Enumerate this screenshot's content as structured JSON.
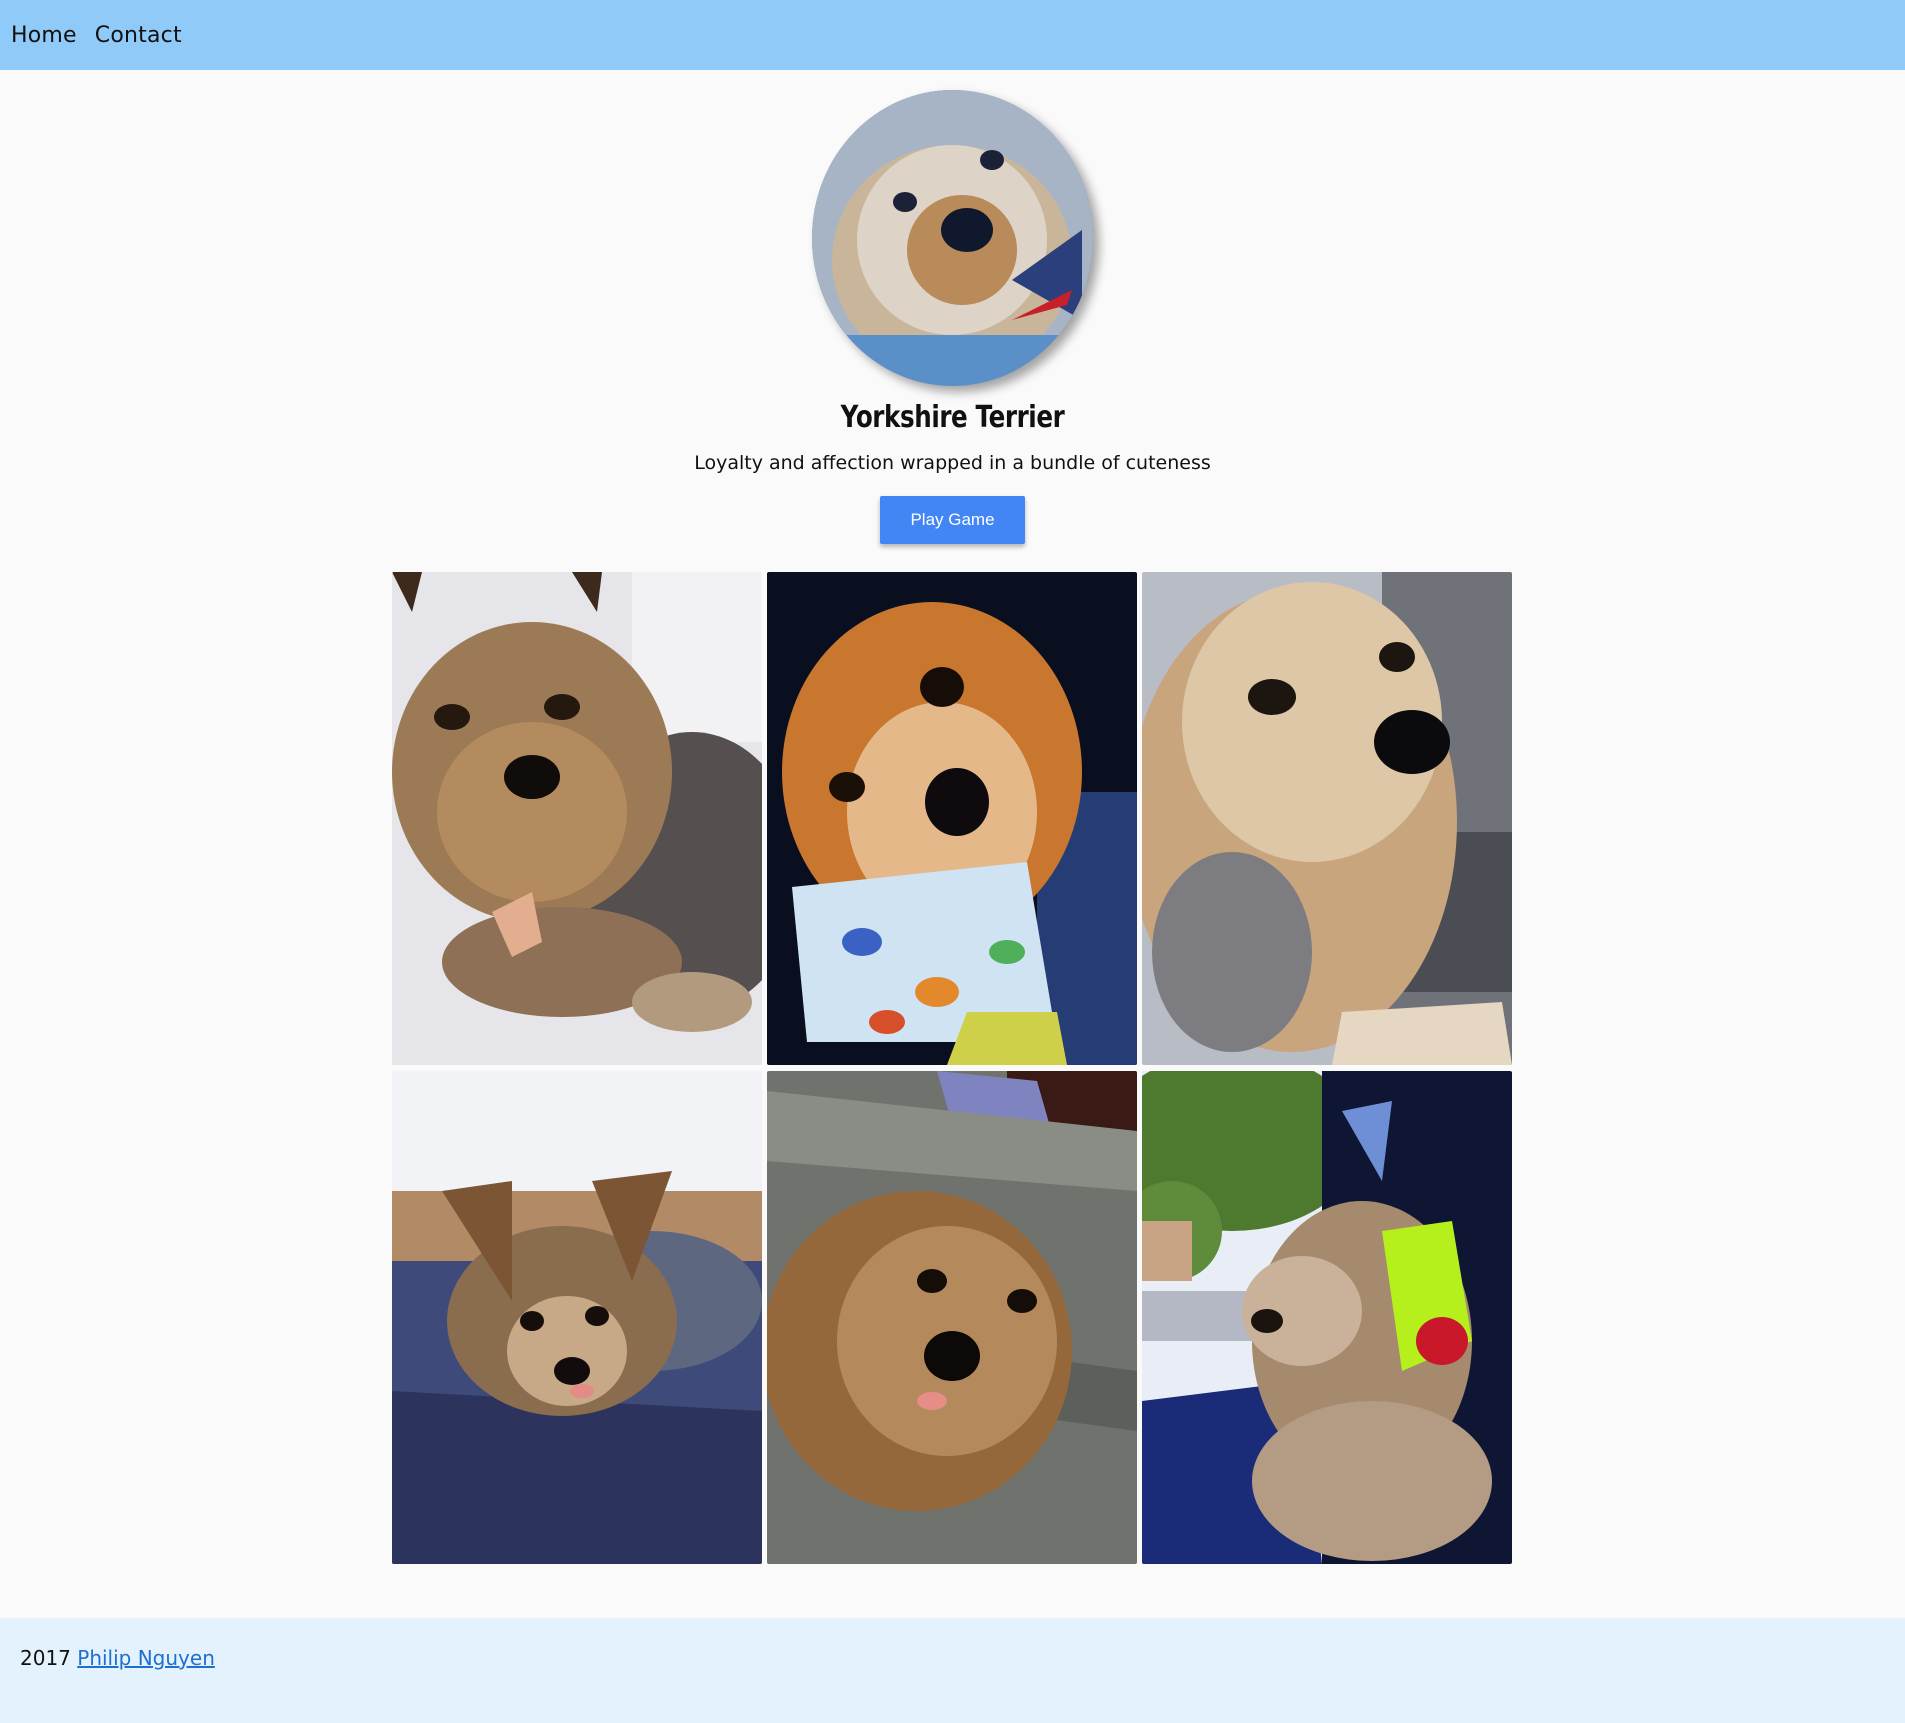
{
  "nav": {
    "items": [
      {
        "label": "Home"
      },
      {
        "label": "Contact"
      }
    ]
  },
  "hero": {
    "avatar_alt": "dog-avatar",
    "title": "Yorkshire Terrier",
    "subtitle": "Loyalty and affection wrapped in a bundle of cuteness",
    "button_label": "Play Game"
  },
  "gallery": {
    "photos": [
      {
        "name": "yorkie-on-bedsheet"
      },
      {
        "name": "yorkie-in-shirt"
      },
      {
        "name": "yorkie-in-car"
      },
      {
        "name": "yorkie-on-blue-blanket"
      },
      {
        "name": "yorkie-on-grey-blanket"
      },
      {
        "name": "yorkie-at-car-window"
      }
    ]
  },
  "footer": {
    "year": "2017",
    "author_link": "Philip Nguyen"
  },
  "colors": {
    "nav_bg": "#90caf9",
    "footer_bg": "#e3f2fd",
    "button_bg": "#4285f4",
    "link": "#1e6fd0"
  }
}
